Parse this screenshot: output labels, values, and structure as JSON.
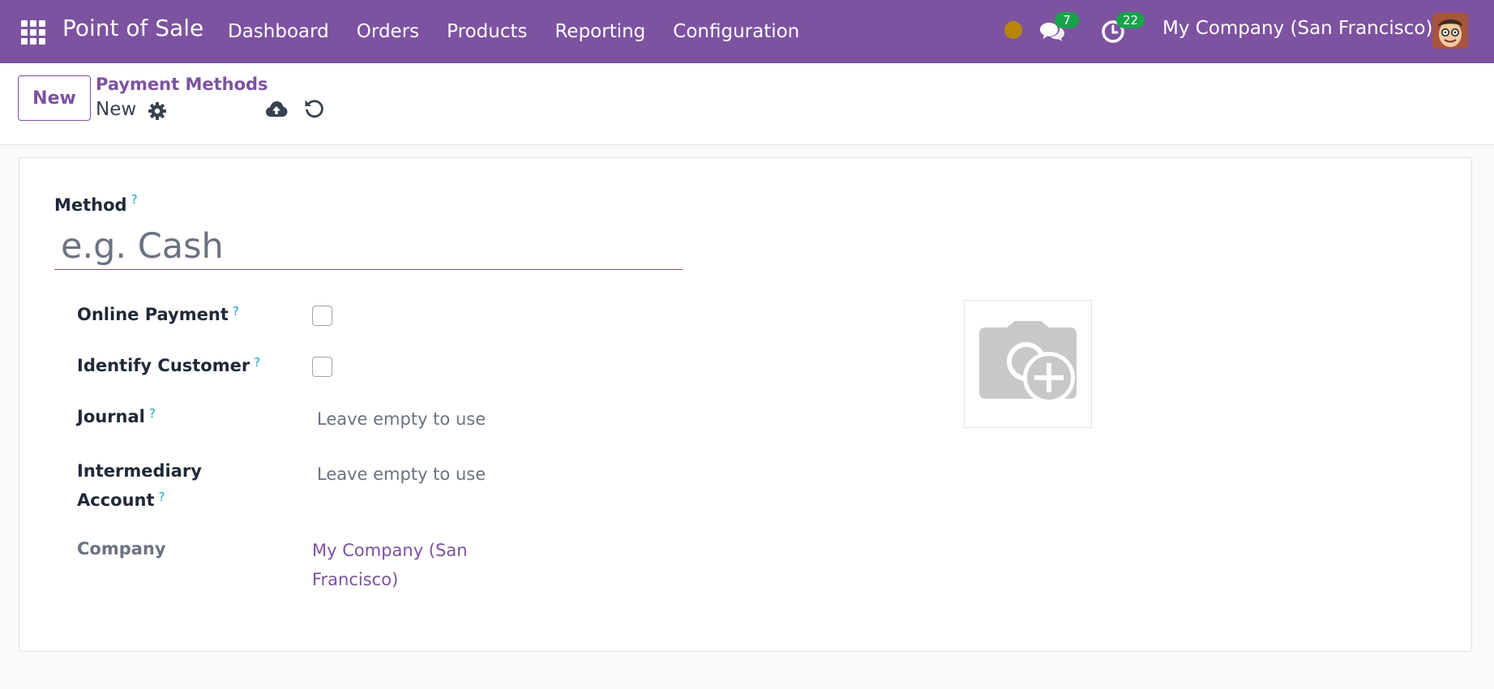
{
  "navbar": {
    "brand": "Point of Sale",
    "menu": [
      "Dashboard",
      "Orders",
      "Products",
      "Reporting",
      "Configuration"
    ],
    "messages_count": "7",
    "activities_count": "22",
    "company": "My Company (San Francisco)",
    "status_color": "#b8860b",
    "accent": "#7d52a0"
  },
  "control": {
    "new_label": "New",
    "breadcrumb": "Payment Methods",
    "record_title": "New"
  },
  "form": {
    "method_label": "Method",
    "method_placeholder": "e.g. Cash",
    "help_mark": "?",
    "online_payment_label": "Online Payment",
    "identify_customer_label": "Identify Customer",
    "journal_label": "Journal",
    "journal_placeholder": "Leave empty to use the default",
    "intermediary_label_line1": "Intermediary",
    "intermediary_label_line2": "Account",
    "intermediary_placeholder": "Leave empty to use the default",
    "company_label": "Company",
    "company_value_line1": "My Company (San",
    "company_value_line2": "Francisco)"
  }
}
